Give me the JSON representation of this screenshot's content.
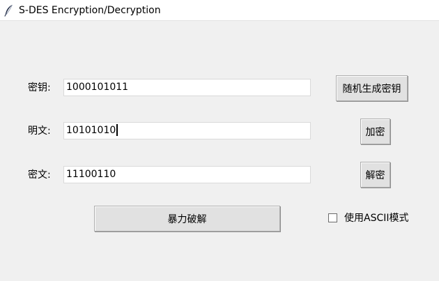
{
  "window": {
    "title": "S-DES Encryption/Decryption",
    "icon": "feather-icon"
  },
  "fields": {
    "key": {
      "label": "密钥:",
      "value": "1000101011"
    },
    "plaintext": {
      "label": "明文:",
      "value": "10101010"
    },
    "ciphertext": {
      "label": "密文:",
      "value": "11100110"
    }
  },
  "buttons": {
    "random_key": "随机生成密钥",
    "encrypt": "加密",
    "decrypt": "解密",
    "brute_force": "暴力破解"
  },
  "options": {
    "ascii_mode": {
      "label": "使用ASCII模式",
      "checked": false
    }
  }
}
